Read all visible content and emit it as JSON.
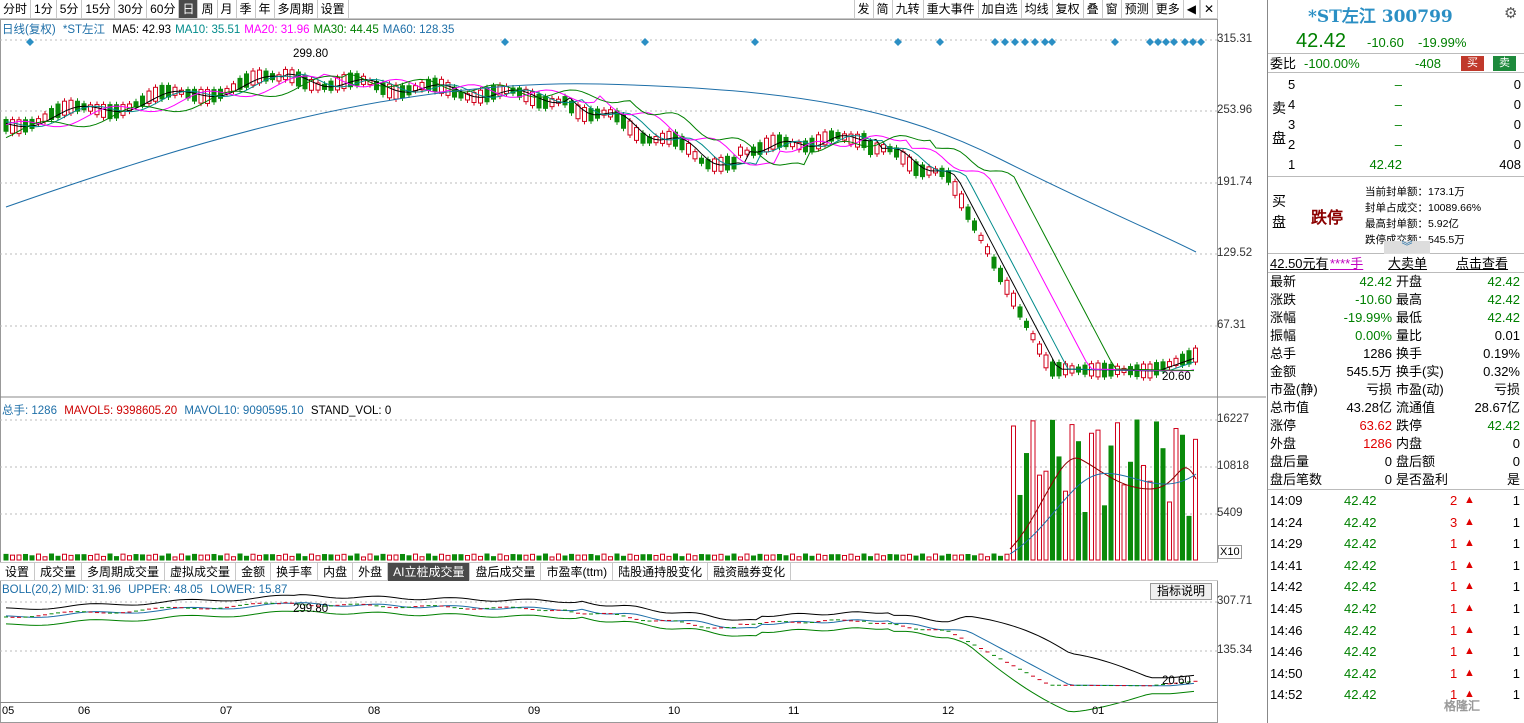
{
  "toolbar": {
    "left": [
      "分时",
      "1分",
      "5分",
      "15分",
      "30分",
      "60分",
      "日",
      "周",
      "月",
      "季",
      "年",
      "多周期",
      "设置"
    ],
    "active": "日",
    "right": [
      "发",
      "简",
      "九转",
      "重大事件",
      "加自选",
      "均线",
      "复权",
      "叠",
      "窗",
      "预测",
      "更多"
    ]
  },
  "kline": {
    "title": "日线(复权)",
    "name": "*ST左江",
    "ma": [
      {
        "label": "MA5: 42.93",
        "color": "#000000"
      },
      {
        "label": "MA10: 35.51",
        "color": "#008b8b"
      },
      {
        "label": "MA20: 31.96",
        "color": "#ff00ff"
      },
      {
        "label": "MA30: 44.45",
        "color": "#008000"
      },
      {
        "label": "MA60: 128.35",
        "color": "#1e6fa8"
      }
    ],
    "y_ticks": [
      "315.31",
      "253.96",
      "191.74",
      "129.52",
      "67.31"
    ],
    "high_label": "299.80",
    "low_label": "20.60"
  },
  "volume": {
    "labels": [
      "总手: 1286",
      "MAVOL5: 9398605.20",
      "MAVOL10: 9090595.10",
      "STAND_VOL: 0"
    ],
    "y_ticks": [
      "16227",
      "10818",
      "5409"
    ],
    "unit": "X10"
  },
  "subtabs": [
    "设置",
    "成交量",
    "多周期成交量",
    "虚拟成交量",
    "金额",
    "换手率",
    "内盘",
    "外盘",
    "AI立桩成交量",
    "盘后成交量",
    "市盈率(ttm)",
    "陆股通持股变化",
    "融资融券变化"
  ],
  "subtabs_active": "AI立桩成交量",
  "boll": {
    "labels": [
      "BOLL(20,2) MID: 31.96",
      "UPPER: 48.05",
      "LOWER: 15.87"
    ],
    "y_ticks": [
      "307.71",
      "135.34"
    ],
    "help": "指标说明",
    "high_label": "299.80",
    "low_label": "20.60"
  },
  "x_months": [
    "05",
    "06",
    "07",
    "08",
    "09",
    "10",
    "11",
    "12",
    "01"
  ],
  "side": {
    "name": "*ST左江",
    "code": "300799",
    "price": "42.42",
    "change": "-10.60",
    "pct": "-19.99%",
    "weibi_label": "委比",
    "weibi": "-100.00%",
    "weicha": "-408",
    "sell_btn": "买",
    "buy_btn": "卖",
    "sell_side": "卖盘",
    "asks": [
      {
        "lvl": "5",
        "price": "–",
        "vol": "0"
      },
      {
        "lvl": "4",
        "price": "–",
        "vol": "0"
      },
      {
        "lvl": "3",
        "price": "–",
        "vol": "0"
      },
      {
        "lvl": "2",
        "price": "–",
        "vol": "0"
      },
      {
        "lvl": "1",
        "price": "42.42",
        "vol": "408"
      }
    ],
    "buy_side": "买盘",
    "limit_tag": "跌停",
    "limit_info": [
      "当前封单额：173.1万",
      "封单占成交：10089.66%",
      "最高封单额：5.92亿",
      "跌停成交额：545.5万"
    ],
    "bigorder": [
      "42.50元有",
      "****手",
      "大卖单",
      "点击查看"
    ],
    "stats": [
      [
        "最新",
        "42.42",
        "开盘",
        "42.42"
      ],
      [
        "涨跌",
        "-10.60",
        "最高",
        "42.42"
      ],
      [
        "涨幅",
        "-19.99%",
        "最低",
        "42.42"
      ],
      [
        "振幅",
        "0.00%",
        "量比",
        "0.01"
      ],
      [
        "总手",
        "1286",
        "换手",
        "0.19%"
      ],
      [
        "金额",
        "545.5万",
        "换手(实)",
        "0.32%"
      ],
      [
        "市盈(静)",
        "亏损",
        "市盈(动)",
        "亏损"
      ],
      [
        "总市值",
        "43.28亿",
        "流通值",
        "28.67亿"
      ],
      [
        "涨停",
        "63.62",
        "跌停",
        "42.42"
      ],
      [
        "外盘",
        "1286",
        "内盘",
        "0"
      ],
      [
        "盘后量",
        "0",
        "盘后额",
        "0"
      ],
      [
        "盘后笔数",
        "0",
        "是否盈利",
        "是"
      ]
    ],
    "ticks": [
      {
        "t": "14:09",
        "p": "42.42",
        "v": "2",
        "n": "1"
      },
      {
        "t": "14:24",
        "p": "42.42",
        "v": "3",
        "n": "1"
      },
      {
        "t": "14:29",
        "p": "42.42",
        "v": "1",
        "n": "1"
      },
      {
        "t": "14:41",
        "p": "42.42",
        "v": "1",
        "n": "1"
      },
      {
        "t": "14:42",
        "p": "42.42",
        "v": "1",
        "n": "1"
      },
      {
        "t": "14:45",
        "p": "42.42",
        "v": "1",
        "n": "1"
      },
      {
        "t": "14:46",
        "p": "42.42",
        "v": "1",
        "n": "1"
      },
      {
        "t": "14:46",
        "p": "42.42",
        "v": "1",
        "n": "1"
      },
      {
        "t": "14:50",
        "p": "42.42",
        "v": "1",
        "n": "1"
      },
      {
        "t": "14:52",
        "p": "42.42",
        "v": "1",
        "n": "1"
      }
    ],
    "watermark": "格隆汇"
  }
}
